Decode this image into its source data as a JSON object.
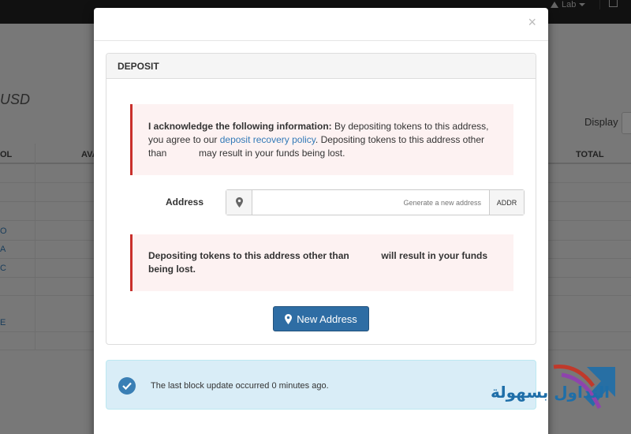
{
  "background": {
    "top_menu_label": "Lab",
    "page_title_fragment": "USD",
    "display_label": "Display",
    "table_headers": [
      "OL",
      "AVA",
      "TOTAL"
    ],
    "row_fragments": [
      "",
      "",
      "",
      "O",
      "A",
      "C",
      "",
      "E",
      ""
    ]
  },
  "modal": {
    "close_glyph": "×",
    "panel_title": "DEPOSIT",
    "alert1": {
      "lead": "I acknowledge the following information:",
      "text_a": " By depositing tokens to this address, you agree to our ",
      "link": "deposit recovery policy",
      "text_b": ". Depositing tokens to this address other than ",
      "text_c": " may result in your funds being lost."
    },
    "address": {
      "label": "Address",
      "placeholder": "Generate a new address",
      "addon_button": "ADDR"
    },
    "alert2": {
      "text_a": "Depositing tokens to this address other than ",
      "text_b": " will result in your funds being lost."
    },
    "new_address_button": "New Address",
    "info": {
      "text": "The last block update occurred 0 minutes ago."
    },
    "watermark_text": "التداول بسهولة"
  },
  "colors": {
    "primary": "#2e6da4",
    "danger": "#c9302c",
    "info_bg": "#d9edf7"
  }
}
